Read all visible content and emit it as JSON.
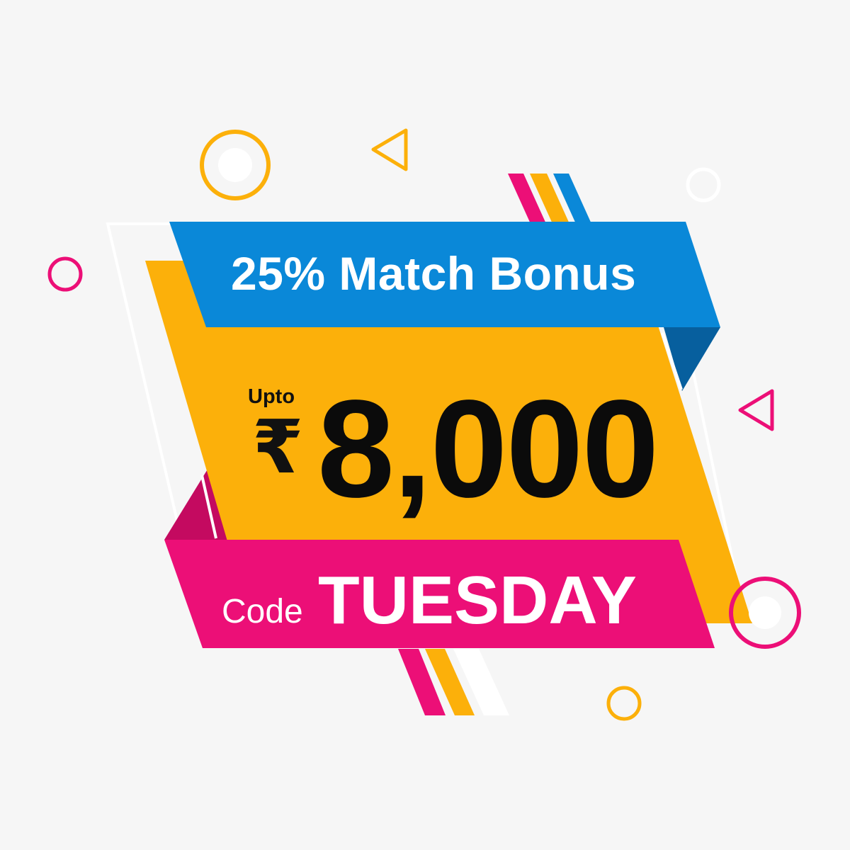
{
  "offer": {
    "headline": "25% Match Bonus",
    "upto_label": "Upto",
    "currency_symbol": "₹",
    "amount": "8,000",
    "code_label": "Code",
    "code_value": "TUESDAY"
  },
  "colors": {
    "background": "#f6f6f6",
    "blue": "#0a88d8",
    "blue_dark": "#075f9e",
    "yellow": "#fcb00a",
    "pink": "#ec0f77",
    "pink_dark": "#c40a60",
    "white": "#ffffff",
    "text_dark": "#0b0b0b"
  }
}
